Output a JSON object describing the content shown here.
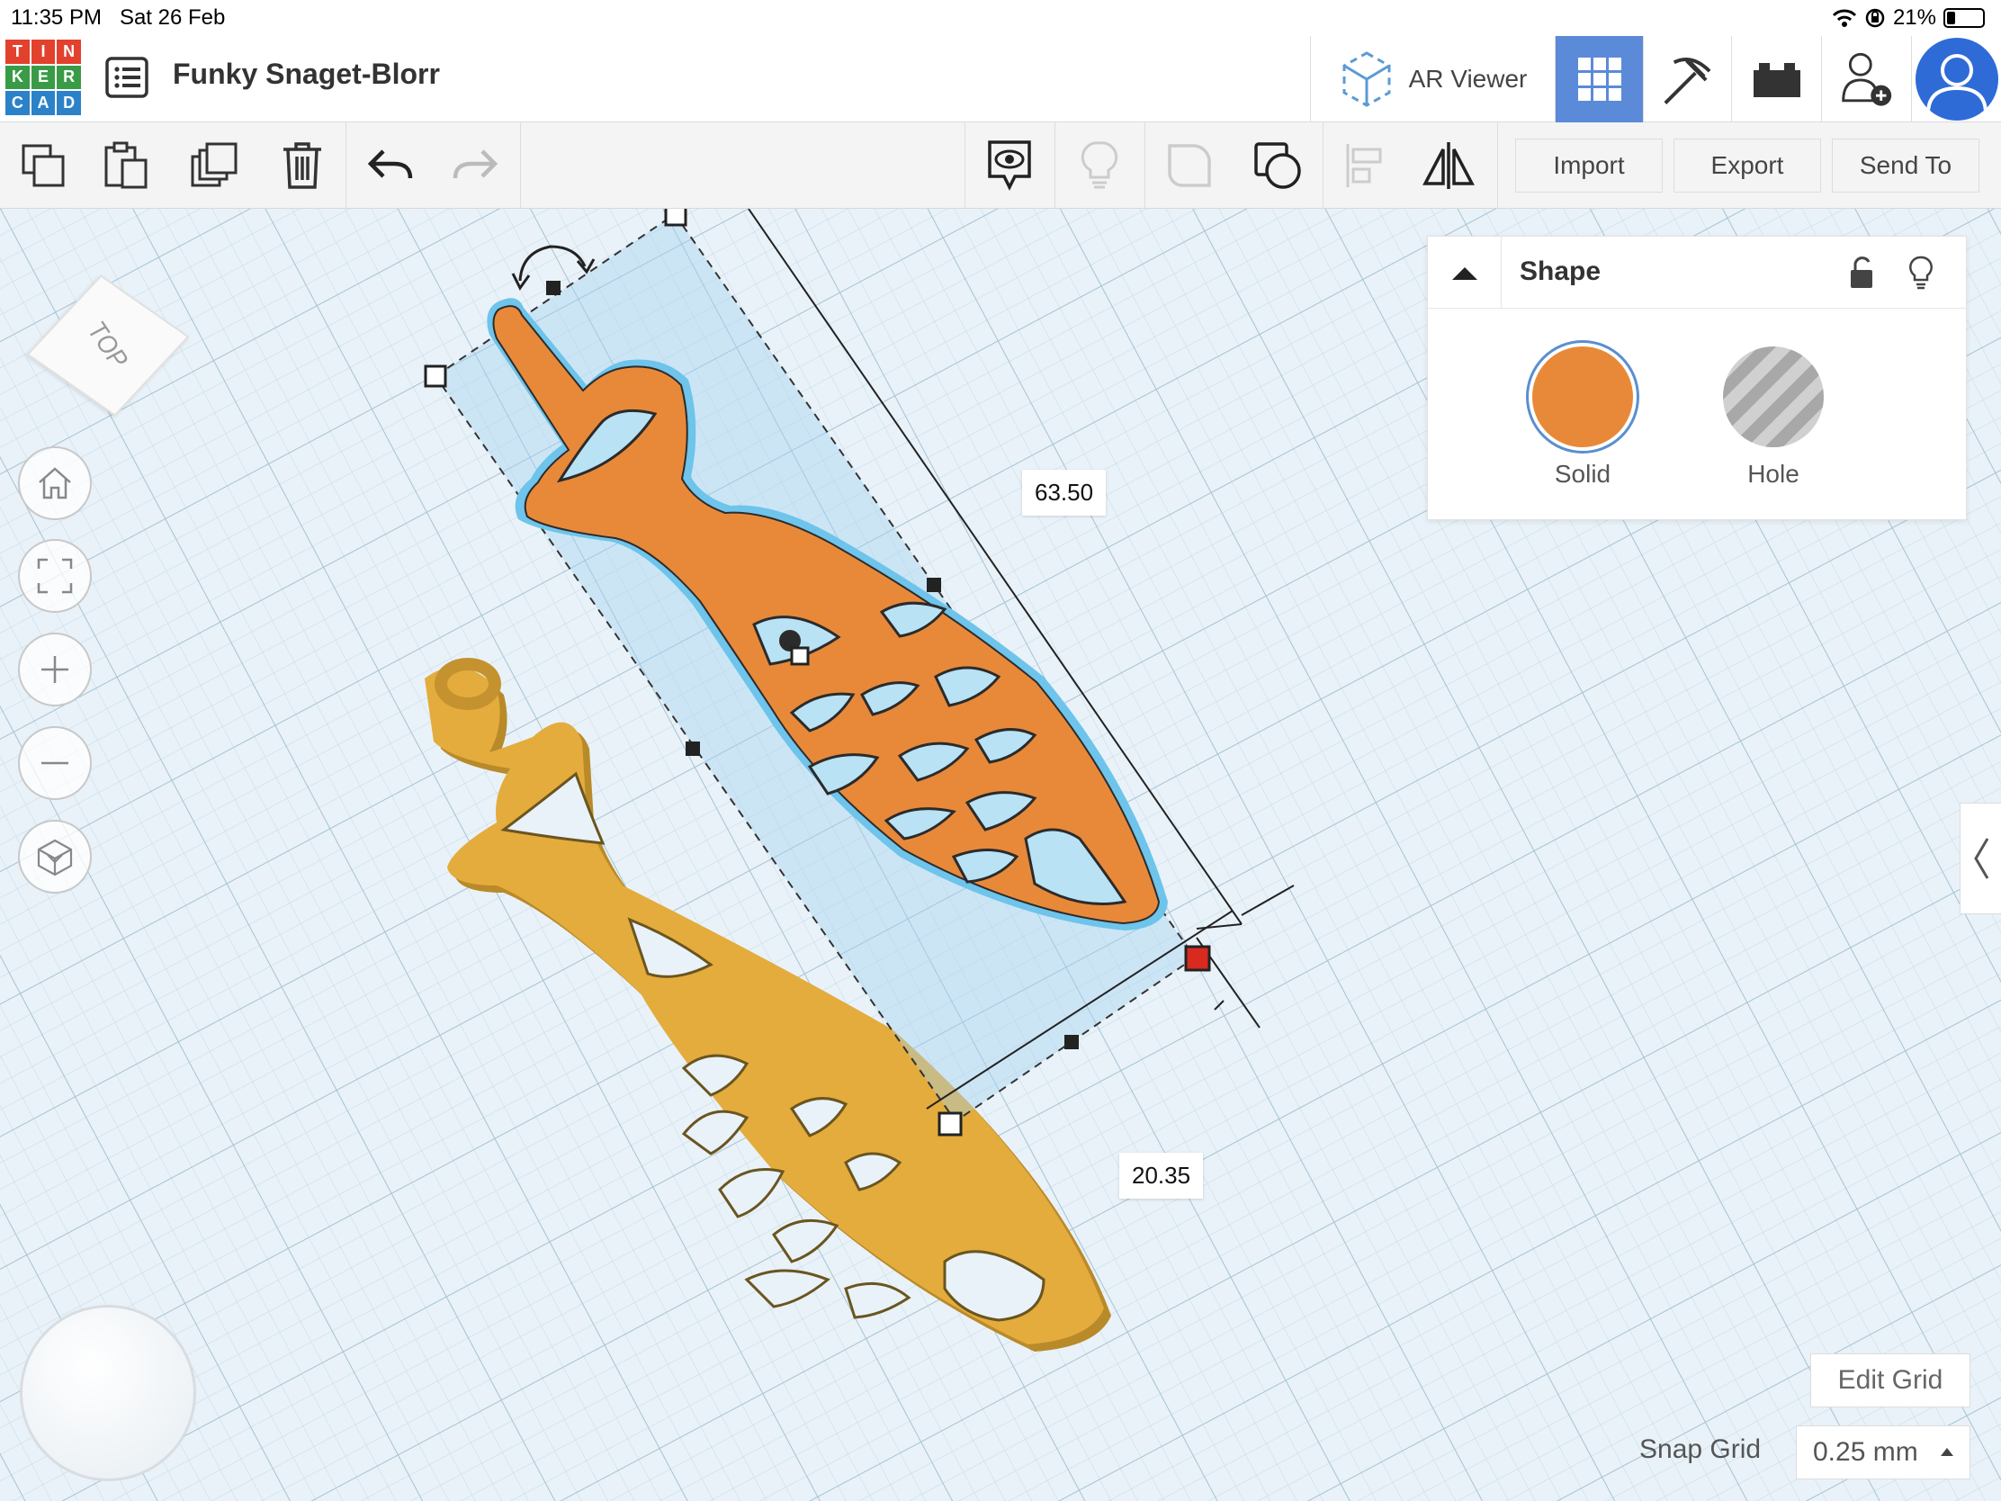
{
  "status_bar": {
    "time": "11:35 PM",
    "date": "Sat 26 Feb",
    "battery": "21%",
    "wifi_icon": "wifi-icon",
    "lock_icon": "orientation-lock-icon"
  },
  "header": {
    "logo_letters": [
      "T",
      "I",
      "N",
      "K",
      "E",
      "R",
      "C",
      "A",
      "D"
    ],
    "logo_colors": [
      "#e2412d",
      "#e2412d",
      "#e2412d",
      "#3a9b47",
      "#3a9b47",
      "#3a9b47",
      "#2c82c9",
      "#2c82c9",
      "#2c82c9"
    ],
    "title": "Funky Snaget-Blorr",
    "ar_viewer_label": "AR Viewer",
    "icons": [
      "list-icon",
      "ar-cube-icon",
      "grid-3d-icon",
      "pickaxe-icon",
      "bricks-icon",
      "add-user-icon",
      "avatar-icon"
    ]
  },
  "toolbar": {
    "icons": [
      "copy-icon",
      "paste-icon",
      "duplicate-icon",
      "delete-icon",
      "undo-icon",
      "redo-icon",
      "show-notes-icon",
      "light-bulb-icon",
      "group-icon",
      "ungroup-icon",
      "align-icon",
      "mirror-icon"
    ],
    "import_label": "Import",
    "export_label": "Export",
    "send_to_label": "Send To"
  },
  "viewcube": {
    "face_label": "TOP"
  },
  "nav_controls": [
    "home-view-icon",
    "fit-view-icon",
    "zoom-in-icon",
    "zoom-out-icon",
    "perspective-icon"
  ],
  "dimensions": {
    "length": "63.50",
    "width": "20.35"
  },
  "shape_panel": {
    "title": "Shape",
    "solid_label": "Solid",
    "hole_label": "Hole",
    "solid_color": "#e8893a",
    "icons": [
      "collapse-arrow-icon",
      "unlock-icon",
      "light-bulb-icon"
    ]
  },
  "workplane": {
    "edit_grid_label": "Edit Grid",
    "snap_grid_label": "Snap Grid",
    "snap_grid_value": "0.25 mm",
    "grid_color": "#c4dae8",
    "orange_fish_color": "#e8893a",
    "gold_fish_color": "#e4ac3c"
  }
}
